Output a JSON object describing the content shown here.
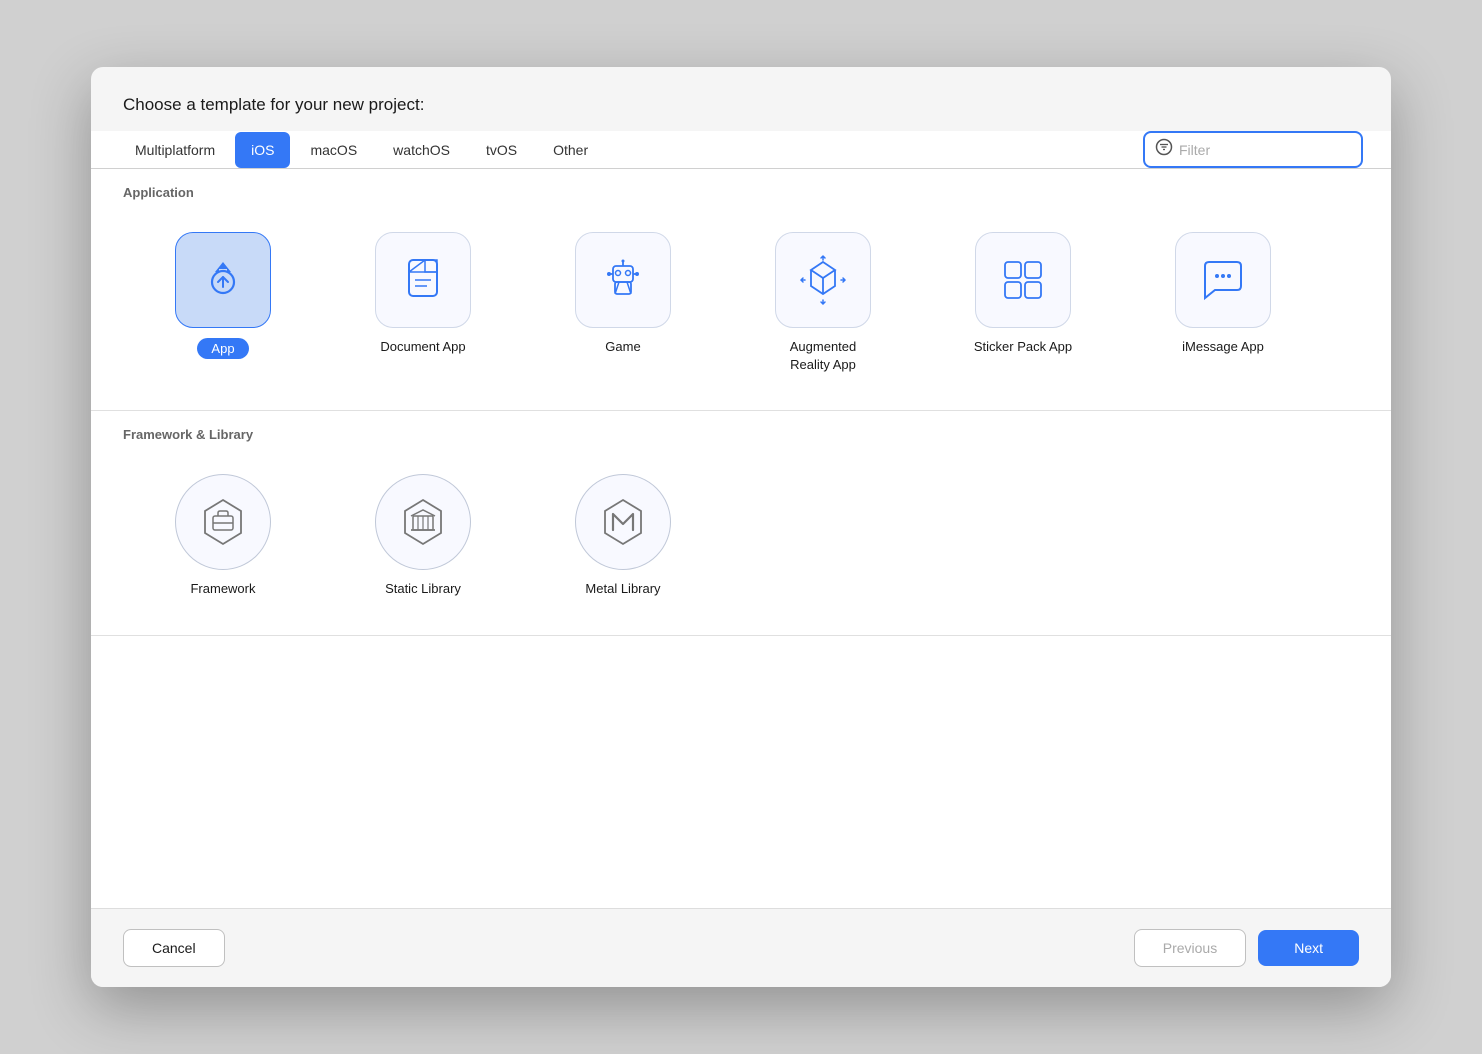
{
  "dialog": {
    "title": "Choose a template for your new project:"
  },
  "tabs": {
    "items": [
      {
        "id": "multiplatform",
        "label": "Multiplatform",
        "active": false
      },
      {
        "id": "ios",
        "label": "iOS",
        "active": true
      },
      {
        "id": "macos",
        "label": "macOS",
        "active": false
      },
      {
        "id": "watchos",
        "label": "watchOS",
        "active": false
      },
      {
        "id": "tvos",
        "label": "tvOS",
        "active": false
      },
      {
        "id": "other",
        "label": "Other",
        "active": false
      }
    ]
  },
  "search": {
    "placeholder": "Filter"
  },
  "sections": {
    "application": {
      "title": "Application",
      "items": [
        {
          "id": "app",
          "label": "App",
          "selected": true
        },
        {
          "id": "document-app",
          "label": "Document App",
          "selected": false
        },
        {
          "id": "game",
          "label": "Game",
          "selected": false
        },
        {
          "id": "ar-app",
          "label": "Augmented\nReality App",
          "selected": false
        },
        {
          "id": "sticker-pack",
          "label": "Sticker Pack App",
          "selected": false
        },
        {
          "id": "imessage-app",
          "label": "iMessage App",
          "selected": false
        }
      ]
    },
    "framework": {
      "title": "Framework & Library",
      "items": [
        {
          "id": "framework",
          "label": "Framework",
          "selected": false
        },
        {
          "id": "static-library",
          "label": "Static Library",
          "selected": false
        },
        {
          "id": "metal-library",
          "label": "Metal Library",
          "selected": false
        }
      ]
    }
  },
  "footer": {
    "cancel_label": "Cancel",
    "previous_label": "Previous",
    "next_label": "Next"
  }
}
